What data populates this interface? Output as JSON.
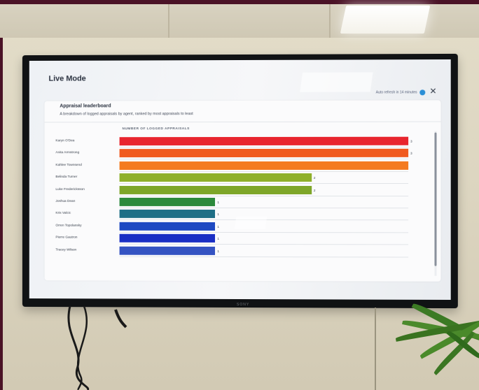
{
  "tv_brand": "SONY",
  "header": {
    "title": "Live Mode",
    "refresh_text": "Auto refresh in 14 minutes",
    "close_symbol": "✕"
  },
  "card": {
    "title": "Appraisal leaderboard",
    "subtitle": "A breakdown of logged appraisals by agent, ranked by most appraisals to least"
  },
  "chart_data": {
    "type": "bar",
    "orientation": "horizontal",
    "xlabel": "NUMBER OF LOGGED APPRAISALS",
    "xlim": [
      0,
      3
    ],
    "grid": true,
    "categories": [
      "Karyn O'Dea",
      "Anita Armstrong",
      "Kahlee Townsend",
      "Belinda Turner",
      "Luke Fredericksson",
      "Joshua Dean",
      "Kris Valcic",
      "Orren Topolansky",
      "Pierre Gautron",
      "Tracey Wilson"
    ],
    "values": [
      3,
      3,
      3,
      2,
      2,
      1,
      1,
      1,
      1,
      1
    ],
    "data_labels": [
      "3",
      "3",
      "",
      "2",
      "2",
      "1",
      "1",
      "1",
      "1",
      "1"
    ],
    "colors": [
      "#e8252e",
      "#f05a1f",
      "#f47b20",
      "#8fb02a",
      "#7ea629",
      "#2c8a3c",
      "#1f6f86",
      "#1e49c2",
      "#1a2fc4",
      "#3453c2",
      "#6d7fb4"
    ]
  }
}
